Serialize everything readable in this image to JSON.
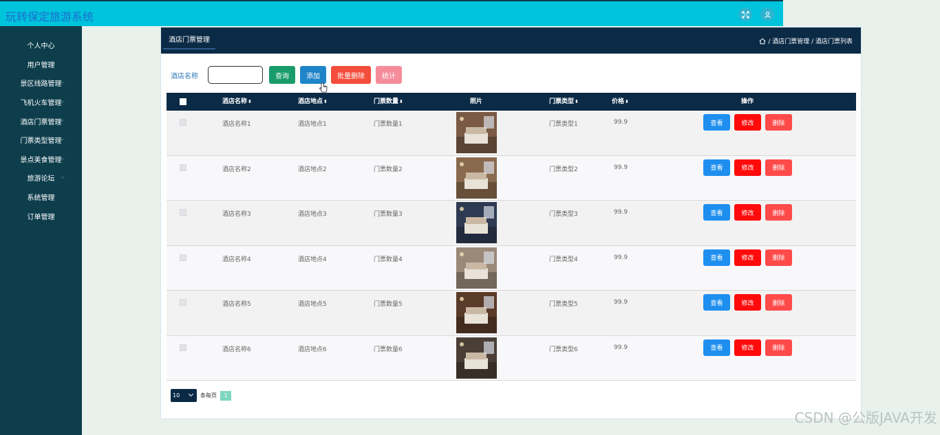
{
  "app": {
    "title": "玩转保定旅游系统",
    "icons": [
      "fullscreen-icon",
      "user-icon"
    ]
  },
  "sidebar": {
    "items": [
      {
        "label": "个人中心",
        "chevron": false
      },
      {
        "label": "用户管理",
        "chevron": false
      },
      {
        "label": "景区线路管理",
        "chevron": true
      },
      {
        "label": "飞机火车管理",
        "chevron": true
      },
      {
        "label": "酒店门票管理",
        "chevron": true
      },
      {
        "label": "门票类型管理",
        "chevron": true
      },
      {
        "label": "景点美食管理",
        "chevron": true
      },
      {
        "label": "旅游论坛",
        "chevron": true
      },
      {
        "label": "系统管理",
        "chevron": false
      },
      {
        "label": "订单管理",
        "chevron": false
      }
    ]
  },
  "panel": {
    "tab": "酒店门票管理",
    "breadcrumb": "/ 酒店门票管理 / 酒店门票列表"
  },
  "search": {
    "label": "酒店名称",
    "value": "",
    "query_label": "查询",
    "add_label": "添加",
    "batch_delete_label": "批量删除",
    "stats_label": "统计"
  },
  "table": {
    "columns": [
      "酒店名称",
      "酒店地点",
      "门票数量",
      "照片",
      "门票类型",
      "价格",
      "操作"
    ],
    "rows": [
      {
        "name": "酒店名称1",
        "location": "酒店地点1",
        "quantity": "门票数量1",
        "type": "门票类型1",
        "price": "99.9",
        "photo_color": "#7a5a44"
      },
      {
        "name": "酒店名称2",
        "location": "酒店地点2",
        "quantity": "门票数量2",
        "type": "门票类型2",
        "price": "99.9",
        "photo_color": "#8a6a4e"
      },
      {
        "name": "酒店名称3",
        "location": "酒店地点3",
        "quantity": "门票数量3",
        "type": "门票类型3",
        "price": "99.9",
        "photo_color": "#2e3a52"
      },
      {
        "name": "酒店名称4",
        "location": "酒店地点4",
        "quantity": "门票数量4",
        "type": "门票类型4",
        "price": "99.9",
        "photo_color": "#9a8878"
      },
      {
        "name": "酒店名称5",
        "location": "酒店地点5",
        "quantity": "门票数量5",
        "type": "门票类型5",
        "price": "99.9",
        "photo_color": "#5a3a28"
      },
      {
        "name": "酒店名称6",
        "location": "酒店地点6",
        "quantity": "门票数量6",
        "type": "门票类型6",
        "price": "99.9",
        "photo_color": "#4a3e36"
      }
    ],
    "actions": {
      "view": "查看",
      "edit": "修改",
      "delete": "删除"
    }
  },
  "pager": {
    "page_size": "10",
    "per_page_text": "条每页",
    "current_page": "1"
  },
  "watermark": "CSDN @公版JAVA开发",
  "colors": {
    "topbar": "#00c3dc",
    "sidebar": "#0e3e4c",
    "header": "#0b2a46"
  }
}
